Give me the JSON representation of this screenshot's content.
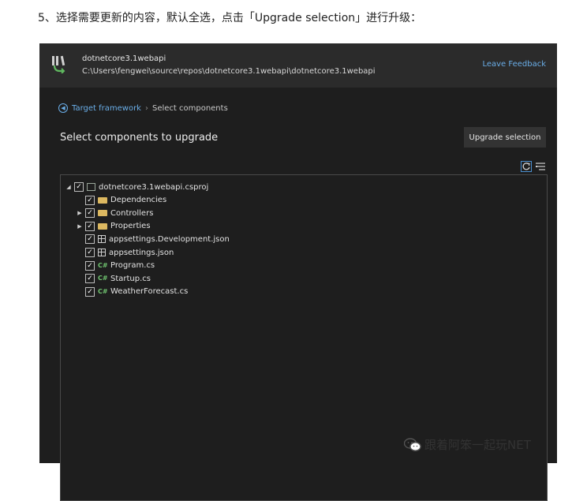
{
  "caption": "5、选择需要更新的内容，默认全选，点击「Upgrade selection」进行升级：",
  "header": {
    "project_name": "dotnetcore3.1webapi",
    "project_path": "C:\\Users\\fengwei\\source\\repos\\dotnetcore3.1webapi\\dotnetcore3.1webapi",
    "feedback_label": "Leave Feedback"
  },
  "breadcrumb": {
    "link": "Target framework",
    "separator": "›",
    "current": "Select components"
  },
  "section_title": "Select components to upgrade",
  "upgrade_button": "Upgrade selection",
  "tree": [
    {
      "label": "dotnetcore3.1webapi.csproj",
      "icon": "project-icon",
      "expander": "expanded",
      "checked": true
    },
    {
      "label": "Dependencies",
      "icon": "folder-icon",
      "expander": "none",
      "checked": true
    },
    {
      "label": "Controllers",
      "icon": "folder-icon",
      "expander": "collapsed",
      "checked": true
    },
    {
      "label": "Properties",
      "icon": "folder-icon",
      "expander": "collapsed",
      "checked": true
    },
    {
      "label": "appsettings.Development.json",
      "icon": "json-file-icon",
      "expander": "none",
      "checked": true
    },
    {
      "label": "appsettings.json",
      "icon": "json-file-icon",
      "expander": "none",
      "checked": true
    },
    {
      "label": "Program.cs",
      "icon": "csharp-file-icon",
      "expander": "none",
      "checked": true
    },
    {
      "label": "Startup.cs",
      "icon": "csharp-file-icon",
      "expander": "none",
      "checked": true
    },
    {
      "label": "WeatherForecast.cs",
      "icon": "csharp-file-icon",
      "expander": "none",
      "checked": true
    }
  ],
  "cs_icon_text": "C#",
  "watermark": "跟着阿笨一起玩NET",
  "colors": {
    "accent": "#6aaee8",
    "folder": "#dcb860",
    "csharp": "#6fc36f",
    "background": "#1e1e1e"
  }
}
